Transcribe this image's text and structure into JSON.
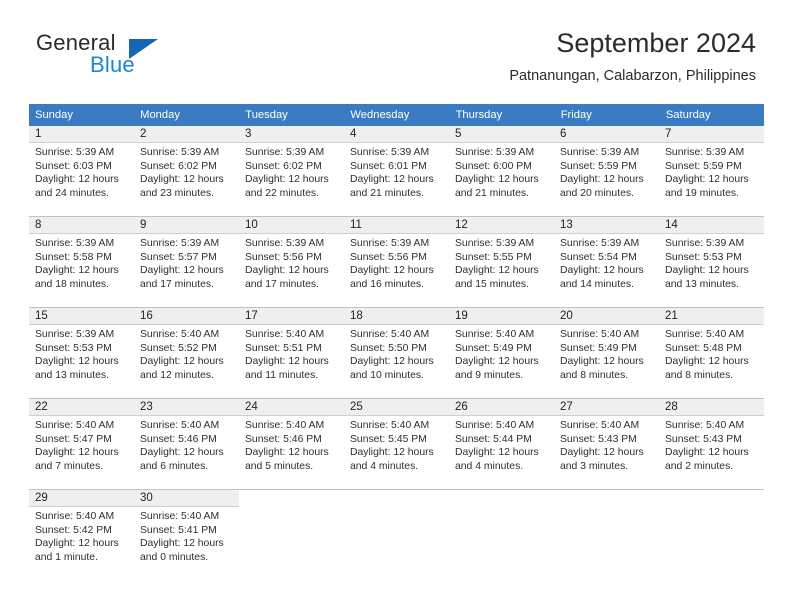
{
  "brand": {
    "word1": "General",
    "word2": "Blue",
    "triangle_color": "#1567b3",
    "blue_color": "#1a86d8"
  },
  "header": {
    "title": "September 2024",
    "subtitle": "Patnanungan, Calabarzon, Philippines"
  },
  "calendar": {
    "header_color": "#3a7cc1",
    "weekdays": [
      "Sunday",
      "Monday",
      "Tuesday",
      "Wednesday",
      "Thursday",
      "Friday",
      "Saturday"
    ],
    "weeks": [
      [
        {
          "day": "1",
          "sunrise": "Sunrise: 5:39 AM",
          "sunset": "Sunset: 6:03 PM",
          "daylight1": "Daylight: 12 hours",
          "daylight2": "and 24 minutes."
        },
        {
          "day": "2",
          "sunrise": "Sunrise: 5:39 AM",
          "sunset": "Sunset: 6:02 PM",
          "daylight1": "Daylight: 12 hours",
          "daylight2": "and 23 minutes."
        },
        {
          "day": "3",
          "sunrise": "Sunrise: 5:39 AM",
          "sunset": "Sunset: 6:02 PM",
          "daylight1": "Daylight: 12 hours",
          "daylight2": "and 22 minutes."
        },
        {
          "day": "4",
          "sunrise": "Sunrise: 5:39 AM",
          "sunset": "Sunset: 6:01 PM",
          "daylight1": "Daylight: 12 hours",
          "daylight2": "and 21 minutes."
        },
        {
          "day": "5",
          "sunrise": "Sunrise: 5:39 AM",
          "sunset": "Sunset: 6:00 PM",
          "daylight1": "Daylight: 12 hours",
          "daylight2": "and 21 minutes."
        },
        {
          "day": "6",
          "sunrise": "Sunrise: 5:39 AM",
          "sunset": "Sunset: 5:59 PM",
          "daylight1": "Daylight: 12 hours",
          "daylight2": "and 20 minutes."
        },
        {
          "day": "7",
          "sunrise": "Sunrise: 5:39 AM",
          "sunset": "Sunset: 5:59 PM",
          "daylight1": "Daylight: 12 hours",
          "daylight2": "and 19 minutes."
        }
      ],
      [
        {
          "day": "8",
          "sunrise": "Sunrise: 5:39 AM",
          "sunset": "Sunset: 5:58 PM",
          "daylight1": "Daylight: 12 hours",
          "daylight2": "and 18 minutes."
        },
        {
          "day": "9",
          "sunrise": "Sunrise: 5:39 AM",
          "sunset": "Sunset: 5:57 PM",
          "daylight1": "Daylight: 12 hours",
          "daylight2": "and 17 minutes."
        },
        {
          "day": "10",
          "sunrise": "Sunrise: 5:39 AM",
          "sunset": "Sunset: 5:56 PM",
          "daylight1": "Daylight: 12 hours",
          "daylight2": "and 17 minutes."
        },
        {
          "day": "11",
          "sunrise": "Sunrise: 5:39 AM",
          "sunset": "Sunset: 5:56 PM",
          "daylight1": "Daylight: 12 hours",
          "daylight2": "and 16 minutes."
        },
        {
          "day": "12",
          "sunrise": "Sunrise: 5:39 AM",
          "sunset": "Sunset: 5:55 PM",
          "daylight1": "Daylight: 12 hours",
          "daylight2": "and 15 minutes."
        },
        {
          "day": "13",
          "sunrise": "Sunrise: 5:39 AM",
          "sunset": "Sunset: 5:54 PM",
          "daylight1": "Daylight: 12 hours",
          "daylight2": "and 14 minutes."
        },
        {
          "day": "14",
          "sunrise": "Sunrise: 5:39 AM",
          "sunset": "Sunset: 5:53 PM",
          "daylight1": "Daylight: 12 hours",
          "daylight2": "and 13 minutes."
        }
      ],
      [
        {
          "day": "15",
          "sunrise": "Sunrise: 5:39 AM",
          "sunset": "Sunset: 5:53 PM",
          "daylight1": "Daylight: 12 hours",
          "daylight2": "and 13 minutes."
        },
        {
          "day": "16",
          "sunrise": "Sunrise: 5:40 AM",
          "sunset": "Sunset: 5:52 PM",
          "daylight1": "Daylight: 12 hours",
          "daylight2": "and 12 minutes."
        },
        {
          "day": "17",
          "sunrise": "Sunrise: 5:40 AM",
          "sunset": "Sunset: 5:51 PM",
          "daylight1": "Daylight: 12 hours",
          "daylight2": "and 11 minutes."
        },
        {
          "day": "18",
          "sunrise": "Sunrise: 5:40 AM",
          "sunset": "Sunset: 5:50 PM",
          "daylight1": "Daylight: 12 hours",
          "daylight2": "and 10 minutes."
        },
        {
          "day": "19",
          "sunrise": "Sunrise: 5:40 AM",
          "sunset": "Sunset: 5:49 PM",
          "daylight1": "Daylight: 12 hours",
          "daylight2": "and 9 minutes."
        },
        {
          "day": "20",
          "sunrise": "Sunrise: 5:40 AM",
          "sunset": "Sunset: 5:49 PM",
          "daylight1": "Daylight: 12 hours",
          "daylight2": "and 8 minutes."
        },
        {
          "day": "21",
          "sunrise": "Sunrise: 5:40 AM",
          "sunset": "Sunset: 5:48 PM",
          "daylight1": "Daylight: 12 hours",
          "daylight2": "and 8 minutes."
        }
      ],
      [
        {
          "day": "22",
          "sunrise": "Sunrise: 5:40 AM",
          "sunset": "Sunset: 5:47 PM",
          "daylight1": "Daylight: 12 hours",
          "daylight2": "and 7 minutes."
        },
        {
          "day": "23",
          "sunrise": "Sunrise: 5:40 AM",
          "sunset": "Sunset: 5:46 PM",
          "daylight1": "Daylight: 12 hours",
          "daylight2": "and 6 minutes."
        },
        {
          "day": "24",
          "sunrise": "Sunrise: 5:40 AM",
          "sunset": "Sunset: 5:46 PM",
          "daylight1": "Daylight: 12 hours",
          "daylight2": "and 5 minutes."
        },
        {
          "day": "25",
          "sunrise": "Sunrise: 5:40 AM",
          "sunset": "Sunset: 5:45 PM",
          "daylight1": "Daylight: 12 hours",
          "daylight2": "and 4 minutes."
        },
        {
          "day": "26",
          "sunrise": "Sunrise: 5:40 AM",
          "sunset": "Sunset: 5:44 PM",
          "daylight1": "Daylight: 12 hours",
          "daylight2": "and 4 minutes."
        },
        {
          "day": "27",
          "sunrise": "Sunrise: 5:40 AM",
          "sunset": "Sunset: 5:43 PM",
          "daylight1": "Daylight: 12 hours",
          "daylight2": "and 3 minutes."
        },
        {
          "day": "28",
          "sunrise": "Sunrise: 5:40 AM",
          "sunset": "Sunset: 5:43 PM",
          "daylight1": "Daylight: 12 hours",
          "daylight2": "and 2 minutes."
        }
      ],
      [
        {
          "day": "29",
          "sunrise": "Sunrise: 5:40 AM",
          "sunset": "Sunset: 5:42 PM",
          "daylight1": "Daylight: 12 hours",
          "daylight2": "and 1 minute."
        },
        {
          "day": "30",
          "sunrise": "Sunrise: 5:40 AM",
          "sunset": "Sunset: 5:41 PM",
          "daylight1": "Daylight: 12 hours",
          "daylight2": "and 0 minutes."
        },
        {
          "day": "",
          "sunrise": "",
          "sunset": "",
          "daylight1": "",
          "daylight2": ""
        },
        {
          "day": "",
          "sunrise": "",
          "sunset": "",
          "daylight1": "",
          "daylight2": ""
        },
        {
          "day": "",
          "sunrise": "",
          "sunset": "",
          "daylight1": "",
          "daylight2": ""
        },
        {
          "day": "",
          "sunrise": "",
          "sunset": "",
          "daylight1": "",
          "daylight2": ""
        },
        {
          "day": "",
          "sunrise": "",
          "sunset": "",
          "daylight1": "",
          "daylight2": ""
        }
      ]
    ]
  }
}
